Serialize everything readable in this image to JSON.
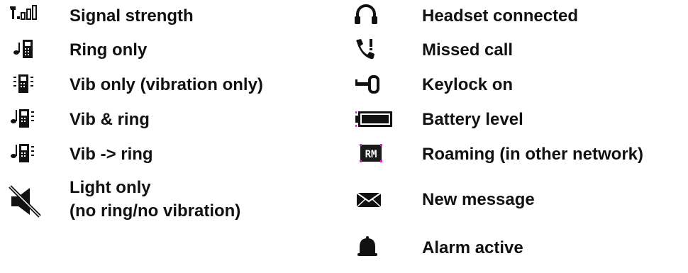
{
  "legend": {
    "left": [
      {
        "icon": "signal-strength-icon",
        "label": "Signal strength"
      },
      {
        "icon": "ring-only-icon",
        "label": "Ring only"
      },
      {
        "icon": "vibration-only-icon",
        "label": "Vib only (vibration only)"
      },
      {
        "icon": "vibration-and-ring-icon",
        "label": "Vib & ring"
      },
      {
        "icon": "vibration-then-ring-icon",
        "label": "Vib -> ring"
      },
      {
        "icon": "muted-speaker-icon",
        "label_line1": "Light only",
        "label_line2": "(no ring/no vibration)"
      }
    ],
    "right": [
      {
        "icon": "headset-icon",
        "label": "Headset connected"
      },
      {
        "icon": "missed-call-icon",
        "label": "Missed call"
      },
      {
        "icon": "key-icon",
        "label": "Keylock on"
      },
      {
        "icon": "battery-icon",
        "label": "Battery level"
      },
      {
        "icon": "roaming-icon",
        "icon_text": "RM",
        "label": "Roaming (in other network)"
      },
      {
        "icon": "envelope-icon",
        "label": "New message"
      },
      {
        "icon": "bell-icon",
        "label": "Alarm active"
      }
    ]
  },
  "colors": {
    "text": "#111111",
    "icon": "#111111",
    "battery_accent": "#e020d0",
    "roaming_bg": "#1a1a1a"
  }
}
